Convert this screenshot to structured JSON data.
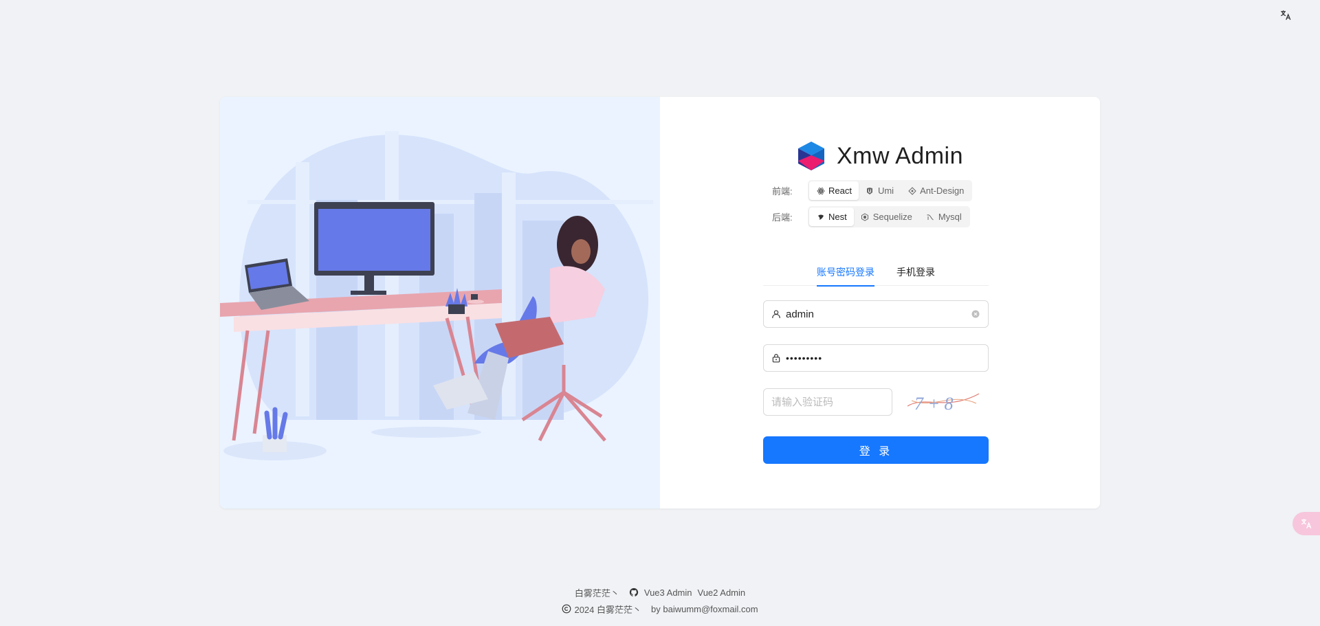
{
  "brand": {
    "title": "Xmw Admin",
    "logo_icon": "cube-logo-icon"
  },
  "frontend": {
    "label": "前端:",
    "items": [
      {
        "label": "React",
        "icon": "react-icon",
        "active": true
      },
      {
        "label": "Umi",
        "icon": "umi-icon",
        "active": false
      },
      {
        "label": "Ant-Design",
        "icon": "antd-icon",
        "active": false
      }
    ]
  },
  "backend": {
    "label": "后端:",
    "items": [
      {
        "label": "Nest",
        "icon": "nest-icon",
        "active": true
      },
      {
        "label": "Sequelize",
        "icon": "sequelize-icon",
        "active": false
      },
      {
        "label": "Mysql",
        "icon": "mysql-icon",
        "active": false
      }
    ]
  },
  "tabs": {
    "account": "账号密码登录",
    "mobile": "手机登录",
    "active": "account"
  },
  "form": {
    "username": "admin",
    "password_mask": "•••••••••",
    "captcha_placeholder": "请输入验证码",
    "captcha_text": "7 + 8",
    "submit": "登 录"
  },
  "footer": {
    "author": "白雾茫茫丶",
    "link_vue3": "Vue3 Admin",
    "link_vue2": "Vue2 Admin",
    "copyright": "2024 白雾茫茫丶",
    "by": "by baiwumm@foxmail.com"
  },
  "colors": {
    "primary": "#1677ff",
    "background": "#f0f2f5",
    "illustration_bg": "#eaf3ff"
  }
}
